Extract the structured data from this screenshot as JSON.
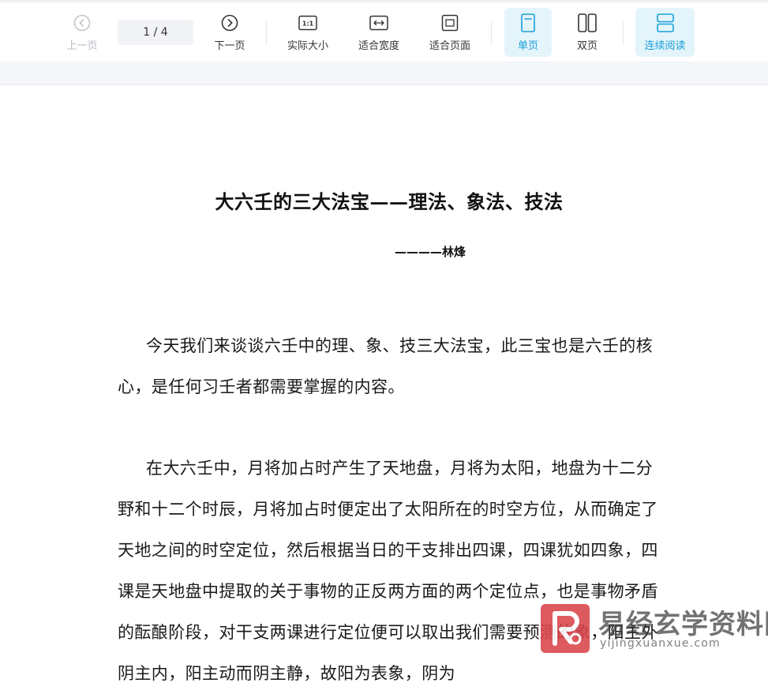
{
  "toolbar": {
    "prev_label": "上一页",
    "page_indicator": "1 / 4",
    "next_label": "下一页",
    "actual_size_label": "实际大小",
    "fit_width_label": "适合宽度",
    "fit_page_label": "适合页面",
    "single_page_label": "单页",
    "double_page_label": "双页",
    "continuous_label": "连续阅读",
    "actual_size_icon_text": "1:1",
    "accent_color": "#1a9fd8",
    "active_bg_color": "#e4f4fb"
  },
  "document": {
    "title": "大六壬的三大法宝——理法、象法、技法",
    "author": "————林烽",
    "paragraphs": [
      "今天我们来谈谈六壬中的理、象、技三大法宝，此三宝也是六壬的核心，是任何习壬者都需要掌握的内容。",
      "在大六壬中，月将加占时产生了天地盘，月将为太阳，地盘为十二分野和十二个时辰，月将加占时便定出了太阳所在的时空方位，从而确定了天地之间的时空定位，然后根据当日的干支排出四课，四课犹如四象，四课是天地盘中提取的关于事物的正反两方面的两个定位点，也是事物矛盾的酝酿阶段，对干支两课进行定位便可以取出我们需要预测的象，阳主外阴主内，阳主动而阴主静，故阳为表象，阴为"
    ]
  },
  "watermark": {
    "brand": "易经玄学资料网",
    "url": "yijingxuanxue.com",
    "logo_color": "#d9444a"
  }
}
